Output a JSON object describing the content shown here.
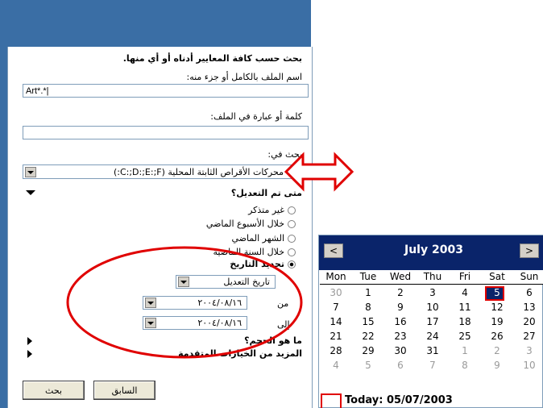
{
  "search_panel": {
    "header": "بحث حسب كافة المعايير أدناه أو أي منها.",
    "filename_label": "اسم الملف بالكامل أو جزء منه:",
    "filename_value": "Art*.*|",
    "word_label": "كلمة أو عبارة في الملف:",
    "word_value": "",
    "look_in_label": "بحث في:",
    "look_in_value": "محركات الأقراص الثابتة المحلية (C:;D:;E:;F:)",
    "modified_title": "متى تم التعديل؟",
    "radio_options": [
      "غير متذكر",
      "خلال الأسبوع الماضي",
      "الشهر الماضي",
      "خلال السنة الماضية",
      "تحديد التاريخ"
    ],
    "date_type": "تاريخ التعديل",
    "from_label": "من",
    "from_value": "٢٠٠٤/٠٨/١٦",
    "to_label": "إلى",
    "to_value": "٢٠٠٤/٠٨/١٦",
    "size_title": "ما هو الحجم؟",
    "advanced_title": "المزيد من الخيارات المتقدمة",
    "back_button": "السابق",
    "search_button": "بحث"
  },
  "calendar": {
    "title": "July 2003",
    "prev_icon": "<",
    "next_icon": ">",
    "weekdays": [
      "Mon",
      "Tue",
      "Wed",
      "Thu",
      "Fri",
      "Sat",
      "Sun"
    ],
    "weeks": [
      [
        "30",
        "1",
        "2",
        "3",
        "4",
        "5",
        "6"
      ],
      [
        "7",
        "8",
        "9",
        "10",
        "11",
        "12",
        "13"
      ],
      [
        "14",
        "15",
        "16",
        "17",
        "18",
        "19",
        "20"
      ],
      [
        "21",
        "22",
        "23",
        "24",
        "25",
        "26",
        "27"
      ],
      [
        "28",
        "29",
        "30",
        "31",
        "1",
        "2",
        "3"
      ],
      [
        "4",
        "5",
        "6",
        "7",
        "8",
        "9",
        "10"
      ]
    ],
    "today_label": "Today: 05/07/2003",
    "selected_day": "5"
  },
  "colors": {
    "accent": "#0a246a",
    "panel_blue": "#3a6ea5",
    "annotation_red": "#e00000"
  }
}
